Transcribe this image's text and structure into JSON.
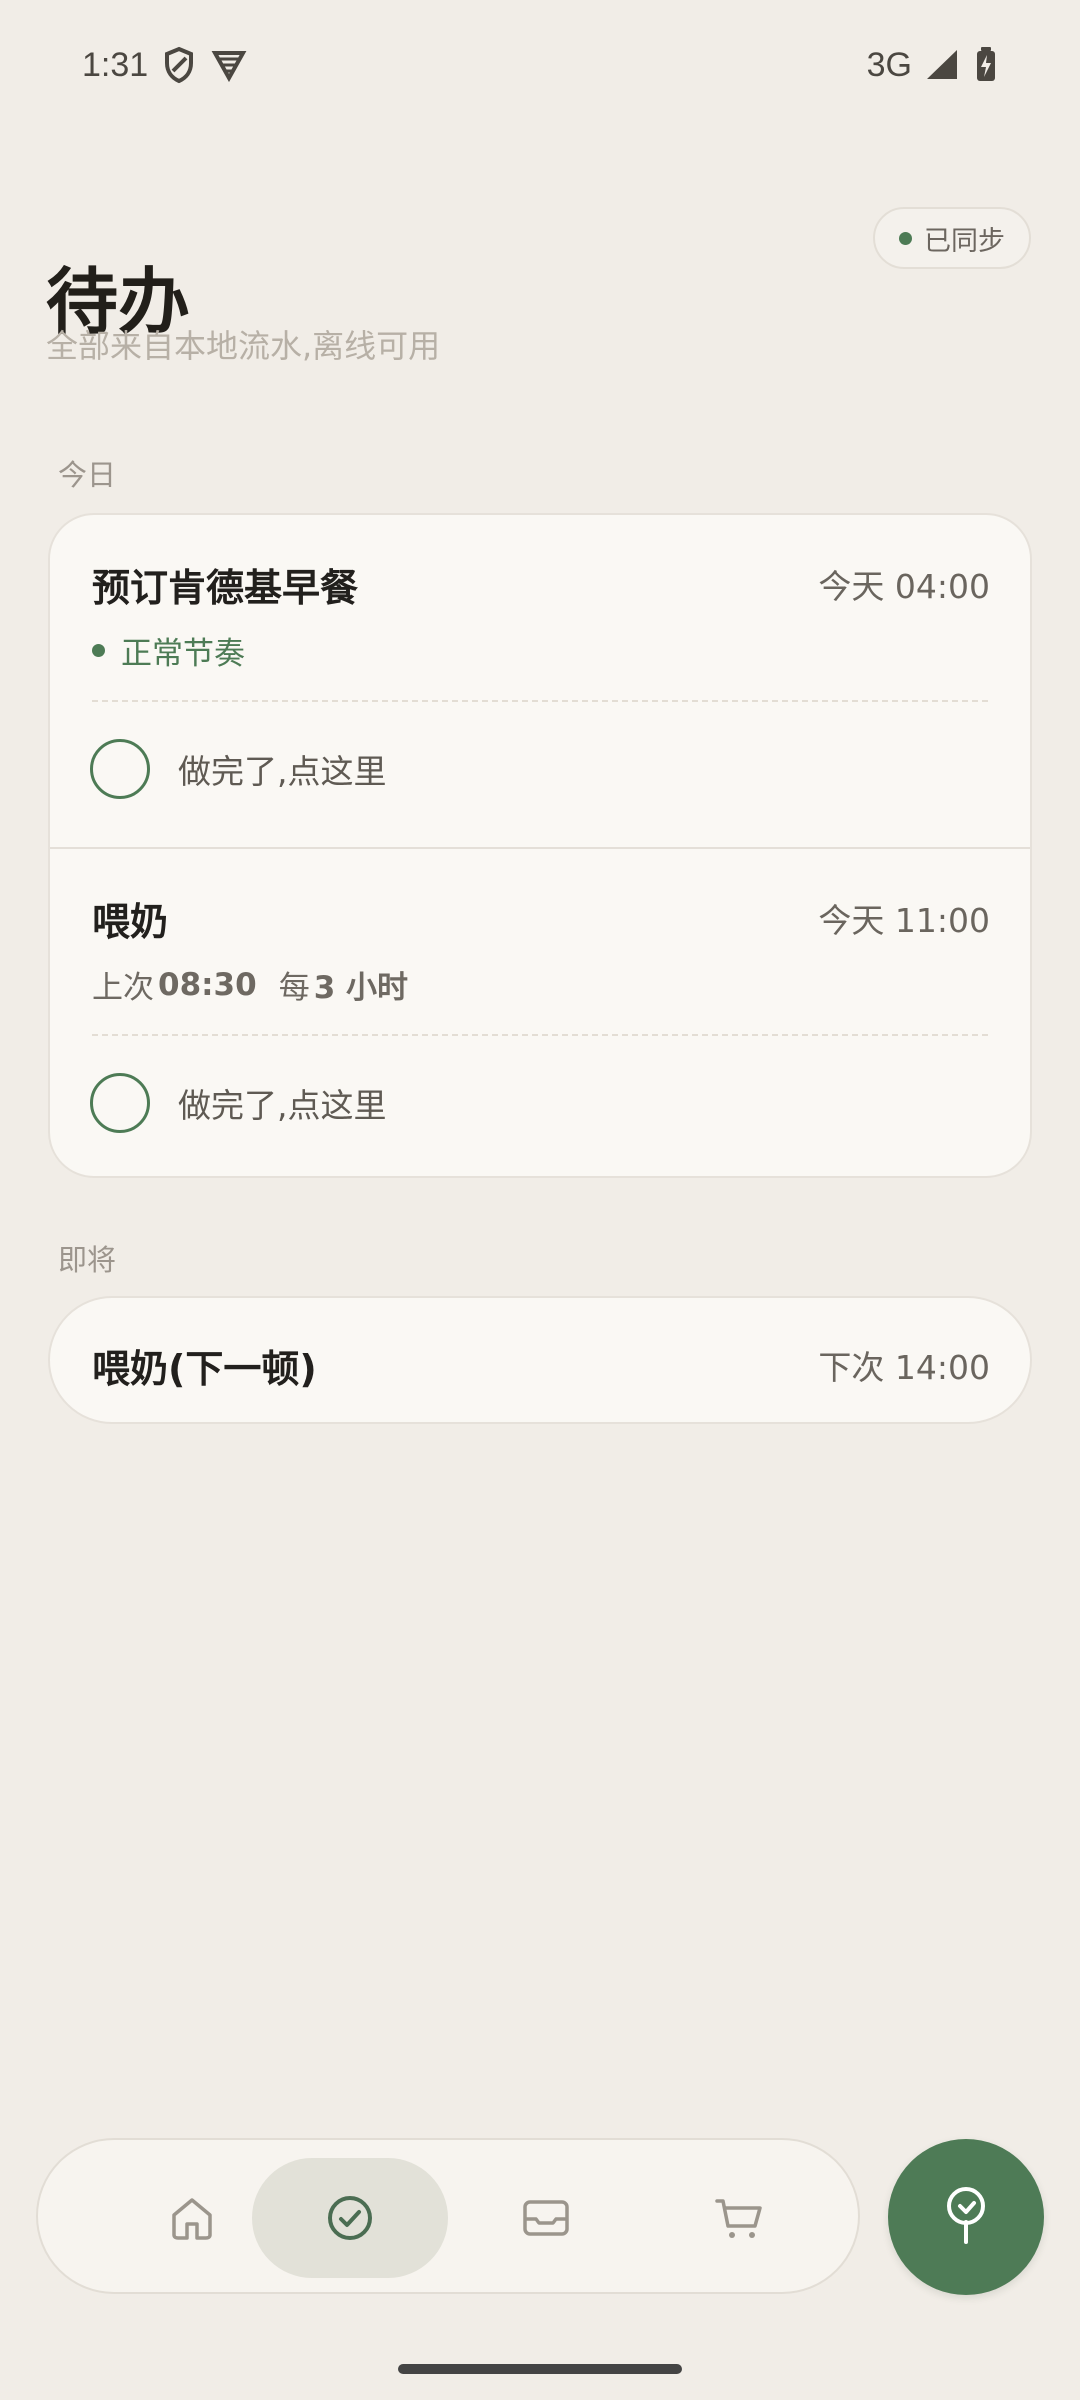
{
  "status_bar": {
    "time": "1:31",
    "network": "3G",
    "icons": [
      "shield-icon",
      "vpn-icon",
      "signal-icon",
      "battery-charging-icon"
    ]
  },
  "header": {
    "title": "待办",
    "subtitle": "全部来自本地流水,离线可用",
    "sync_status": "已同步"
  },
  "sections": {
    "today_label": "今日",
    "upcoming_label": "即将"
  },
  "today_tasks": [
    {
      "title": "预订肯德基早餐",
      "time": "今天 04:00",
      "status": "正常节奏",
      "done_label": "做完了,点这里"
    },
    {
      "title": "喂奶",
      "time": "今天 11:00",
      "last_prefix": "上次",
      "last_time": "08:30",
      "interval_prefix": "每",
      "interval_value": "3 小时",
      "done_label": "做完了,点这里"
    }
  ],
  "upcoming_tasks": [
    {
      "title": "喂奶(下一顿)",
      "time": "下次 14:00"
    }
  ],
  "bottom_nav": {
    "items": [
      {
        "name": "home",
        "icon": "home-icon",
        "active": false
      },
      {
        "name": "todo",
        "icon": "check-circle-icon",
        "active": true
      },
      {
        "name": "inbox",
        "icon": "inbox-icon",
        "active": false
      },
      {
        "name": "cart",
        "icon": "cart-icon",
        "active": false
      }
    ],
    "fab_icon": "tree-icon"
  },
  "colors": {
    "background": "#f1ede7",
    "card": "#faf8f4",
    "accent_green": "#4d7b55",
    "active_nav": "#e2e1d8",
    "text_primary": "#221f1a",
    "text_secondary": "#6a655e"
  }
}
